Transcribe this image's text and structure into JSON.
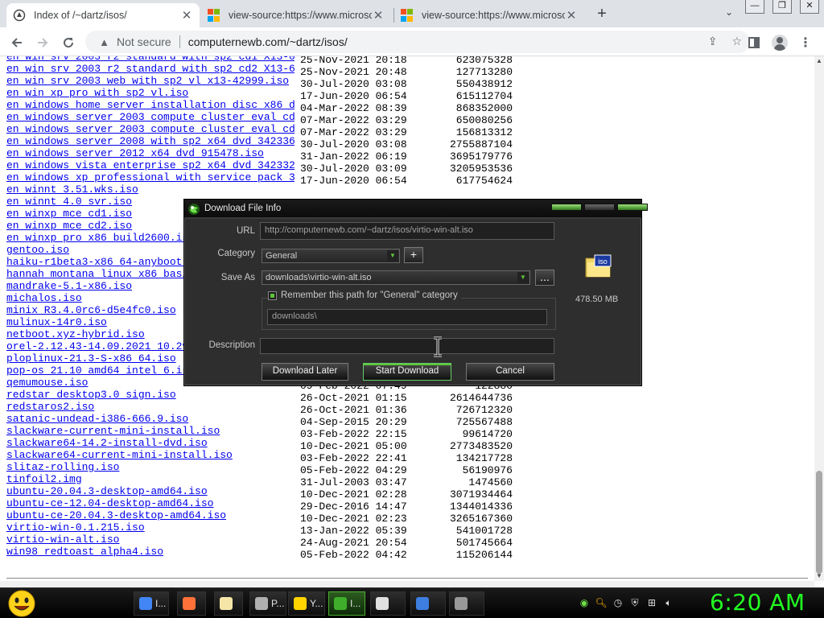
{
  "browser": {
    "tabs": [
      {
        "title": "Index of /~dartz/isos/",
        "active": true
      },
      {
        "title": "view-source:https://www.microsc",
        "active": false
      },
      {
        "title": "view-source:https://www.microsc",
        "active": false
      }
    ],
    "new_tab": "+",
    "window_controls": {
      "minimize": "—",
      "restore": "❐",
      "close": "✕"
    },
    "security_label": "Not secure",
    "url": "computernewb.com/~dartz/isos/"
  },
  "listing": [
    {
      "name": "en_win_srv_2003_r2_standard_with_sp2_cd1_X13-04..>",
      "date": "25-Nov-2021 20:18",
      "size": "623075328"
    },
    {
      "name": "en_win_srv_2003_r2_standard_with_sp2_cd2_X13-68..>",
      "date": "25-Nov-2021 20:48",
      "size": "127713280"
    },
    {
      "name": "en_win_srv_2003_web_with_sp2_vl_x13-42999.iso",
      "date": "30-Jul-2020 03:08",
      "size": "550438912"
    },
    {
      "name": "en_win_xp_pro_with_sp2_vl.iso",
      "date": "17-Jun-2020 06:54",
      "size": "615112704"
    },
    {
      "name": "en_windows_home_server_installation_disc_x86_dv..>",
      "date": "04-Mar-2022 08:39",
      "size": "868352000"
    },
    {
      "name": "en_windows_server_2003_compute_cluster_eval_cd1..>",
      "date": "07-Mar-2022 03:29",
      "size": "650080256"
    },
    {
      "name": "en_windows_server_2003_compute_cluster_eval_cd2..>",
      "date": "07-Mar-2022 03:29",
      "size": "156813312"
    },
    {
      "name": "en_windows_server_2008_with_sp2_x64_dvd_342336.iso",
      "date": "30-Jul-2020 03:08",
      "size": "2755887104"
    },
    {
      "name": "en_windows_server_2012_x64_dvd_915478.iso",
      "date": "31-Jan-2022 06:19",
      "size": "3695179776"
    },
    {
      "name": "en_windows_vista_enterprise_sp2_x64_dvd_342332.iso",
      "date": "30-Jul-2020 03:09",
      "size": "3205953536"
    },
    {
      "name": "en_windows_xp_professional_with_service_pack_3_..>",
      "date": "17-Jun-2020 06:54",
      "size": "617754624"
    },
    {
      "name": "en_winnt_3.51.wks.iso",
      "date": "",
      "size": ""
    },
    {
      "name": "en_winnt_4.0_svr.iso",
      "date": "",
      "size": ""
    },
    {
      "name": "en_winxp_mce_cd1.iso",
      "date": "",
      "size": ""
    },
    {
      "name": "en_winxp_mce_cd2.iso",
      "date": "",
      "size": ""
    },
    {
      "name": "en_winxp_pro_x86_build2600.iso",
      "date": "",
      "size": ""
    },
    {
      "name": "gentoo.iso",
      "date": "",
      "size": ""
    },
    {
      "name": "haiku-r1beta3-x86_64-anyboot.iso",
      "date": "",
      "size": ""
    },
    {
      "name": "hannah_montana_linux_x86_basic_",
      "date": "",
      "size": ""
    },
    {
      "name": "mandrake-5.1-x86.iso",
      "date": "",
      "size": ""
    },
    {
      "name": "michalos.iso",
      "date": "",
      "size": ""
    },
    {
      "name": "minix_R3.4.0rc6-d5e4fc0.iso",
      "date": "",
      "size": ""
    },
    {
      "name": "mulinux-14r0.iso",
      "date": "",
      "size": ""
    },
    {
      "name": "netboot.xyz-hybrid.iso",
      "date": "",
      "size": ""
    },
    {
      "name": "orel-2.12.43-14.09.2021_10.29.",
      "date": "",
      "size": ""
    },
    {
      "name": "ploplinux-21.3-S-x86_64.iso",
      "date": "",
      "size": ""
    },
    {
      "name": "pop-os_21.10_amd64_intel_6.iso",
      "date": "",
      "size": ""
    },
    {
      "name": "qemumouse.iso",
      "date": "09-Feb-2022 07:49",
      "size": "122880"
    },
    {
      "name": "redstar_desktop3.0_sign.iso",
      "date": "26-Oct-2021 01:15",
      "size": "2614644736"
    },
    {
      "name": "redstaros2.iso",
      "date": "26-Oct-2021 01:36",
      "size": "726712320"
    },
    {
      "name": "satanic-undead-i386-666.9.iso",
      "date": "04-Sep-2015 20:29",
      "size": "725567488"
    },
    {
      "name": "slackware-current-mini-install.iso",
      "date": "03-Feb-2022 22:15",
      "size": "99614720"
    },
    {
      "name": "slackware64-14.2-install-dvd.iso",
      "date": "10-Dec-2021 05:00",
      "size": "2773483520"
    },
    {
      "name": "slackware64-current-mini-install.iso",
      "date": "03-Feb-2022 22:41",
      "size": "134217728"
    },
    {
      "name": "slitaz-rolling.iso",
      "date": "05-Feb-2022 04:29",
      "size": "56190976"
    },
    {
      "name": "tinfoil2.img",
      "date": "31-Jul-2003 03:47",
      "size": "1474560"
    },
    {
      "name": "ubuntu-20.04.3-desktop-amd64.iso",
      "date": "10-Dec-2021 02:28",
      "size": "3071934464"
    },
    {
      "name": "ubuntu-ce-12.04-desktop-amd64.iso",
      "date": "29-Dec-2016 14:47",
      "size": "1344014336"
    },
    {
      "name": "ubuntu-ce-20.04.3-desktop-amd64.iso",
      "date": "10-Dec-2021 02:23",
      "size": "3265167360"
    },
    {
      "name": "virtio-win-0.1.215.iso",
      "date": "13-Jan-2022 05:39",
      "size": "541001728"
    },
    {
      "name": "virtio-win-alt.iso",
      "date": "24-Aug-2021 20:54",
      "size": "501745664"
    },
    {
      "name": "win98_redtoast_alpha4.iso",
      "date": "05-Feb-2022 04:42",
      "size": "115206144"
    }
  ],
  "dialog": {
    "title": "Download File Info",
    "url_label": "URL",
    "url_value": "http://computernewb.com/~dartz/isos/virtio-win-alt.iso",
    "category_label": "Category",
    "category_value": "General",
    "add_category": "+",
    "save_as_label": "Save As",
    "save_as_value": "downloads\\virtio-win-alt.iso",
    "browse": "...",
    "remember_label": "Remember this path for \"General\" category",
    "remember_checked": true,
    "path_value": "downloads\\",
    "description_label": "Description",
    "description_value": "",
    "file_icon_text": "iso",
    "file_size": "478.50  MB",
    "buttons": {
      "later": "Download Later",
      "start": "Start Download",
      "cancel": "Cancel"
    }
  },
  "taskbar": {
    "tasks": [
      {
        "label": "I...",
        "icon": "chrome-icon",
        "color": "#4285f4"
      },
      {
        "label": "",
        "icon": "firefox-icon",
        "color": "#ff7139"
      },
      {
        "label": "",
        "icon": "notepad-icon",
        "color": "#f5e6a8"
      },
      {
        "label": "P...",
        "icon": "photo-icon",
        "color": "#b0b0b0"
      },
      {
        "label": "Y...",
        "icon": "yahoo-smiley-icon",
        "color": "#ffd400"
      },
      {
        "label": "I...",
        "icon": "idm-icon",
        "color": "#3fae2a"
      },
      {
        "label": "",
        "icon": "7zip-icon",
        "color": "#e0e0e0"
      },
      {
        "label": "",
        "icon": "settings-icon",
        "color": "#3d7ee0"
      },
      {
        "label": "",
        "icon": "drive-icon",
        "color": "#999999"
      }
    ],
    "clock": "6:20 AM"
  }
}
